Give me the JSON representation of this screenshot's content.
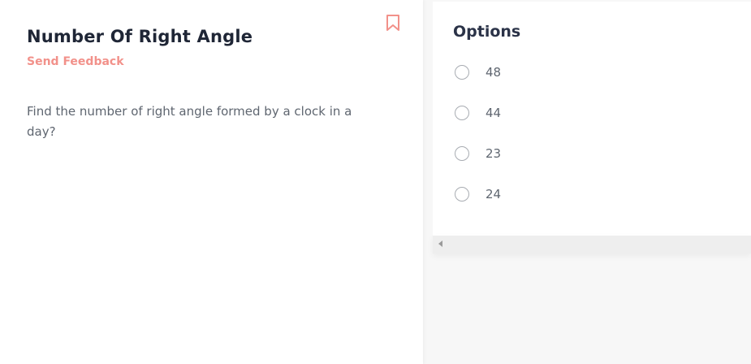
{
  "question": {
    "title": "Number Of Right Angle",
    "feedback_label": "Send Feedback",
    "text": "Find the number of right angle formed by a clock in a day?",
    "bookmark_icon": "bookmark-icon"
  },
  "options": {
    "title": "Options",
    "items": [
      {
        "label": "48"
      },
      {
        "label": "44"
      },
      {
        "label": "23"
      },
      {
        "label": "24"
      }
    ]
  },
  "colors": {
    "accent": "#f2918a",
    "title": "#1f2636",
    "body_text": "#5f6670"
  }
}
